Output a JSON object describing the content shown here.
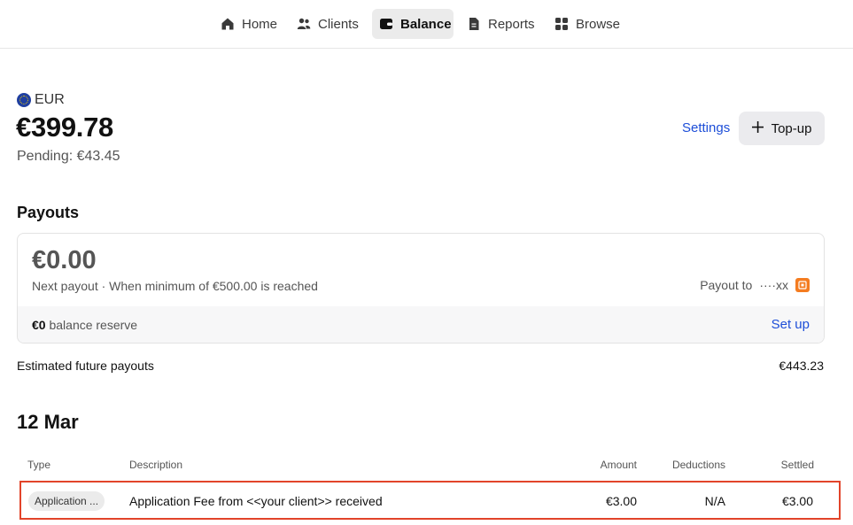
{
  "nav": {
    "items": [
      {
        "label": "Home",
        "icon": "home-icon"
      },
      {
        "label": "Clients",
        "icon": "clients-icon"
      },
      {
        "label": "Balance",
        "icon": "wallet-icon",
        "active": true
      },
      {
        "label": "Reports",
        "icon": "document-icon"
      },
      {
        "label": "Browse",
        "icon": "grid-icon"
      }
    ]
  },
  "balance": {
    "currency": "EUR",
    "amount": "€399.78",
    "pending": "Pending: €43.45",
    "settings_label": "Settings",
    "topup_label": "Top-up"
  },
  "payouts": {
    "title": "Payouts",
    "amount": "€0.00",
    "next_payout": "Next payout · When minimum of €500.00 is reached",
    "payout_to_label": "Payout to",
    "account_mask": "····xx",
    "reserve_amount": "€0",
    "reserve_label": "balance reserve",
    "setup_label": "Set up",
    "estimated_label": "Estimated future payouts",
    "estimated_value": "€443.23"
  },
  "transactions": {
    "date_heading": "12 Mar",
    "columns": {
      "type": "Type",
      "description": "Description",
      "amount": "Amount",
      "deductions": "Deductions",
      "settled": "Settled"
    },
    "rows": [
      {
        "type": "Application ...",
        "description": "Application Fee from <<your client>> received",
        "amount": "€3.00",
        "deductions": "N/A",
        "settled": "€3.00",
        "highlight_color": "#e2442a"
      }
    ]
  },
  "colors": {
    "link": "#1d4ed8",
    "bank_brand": "#f47c20"
  }
}
